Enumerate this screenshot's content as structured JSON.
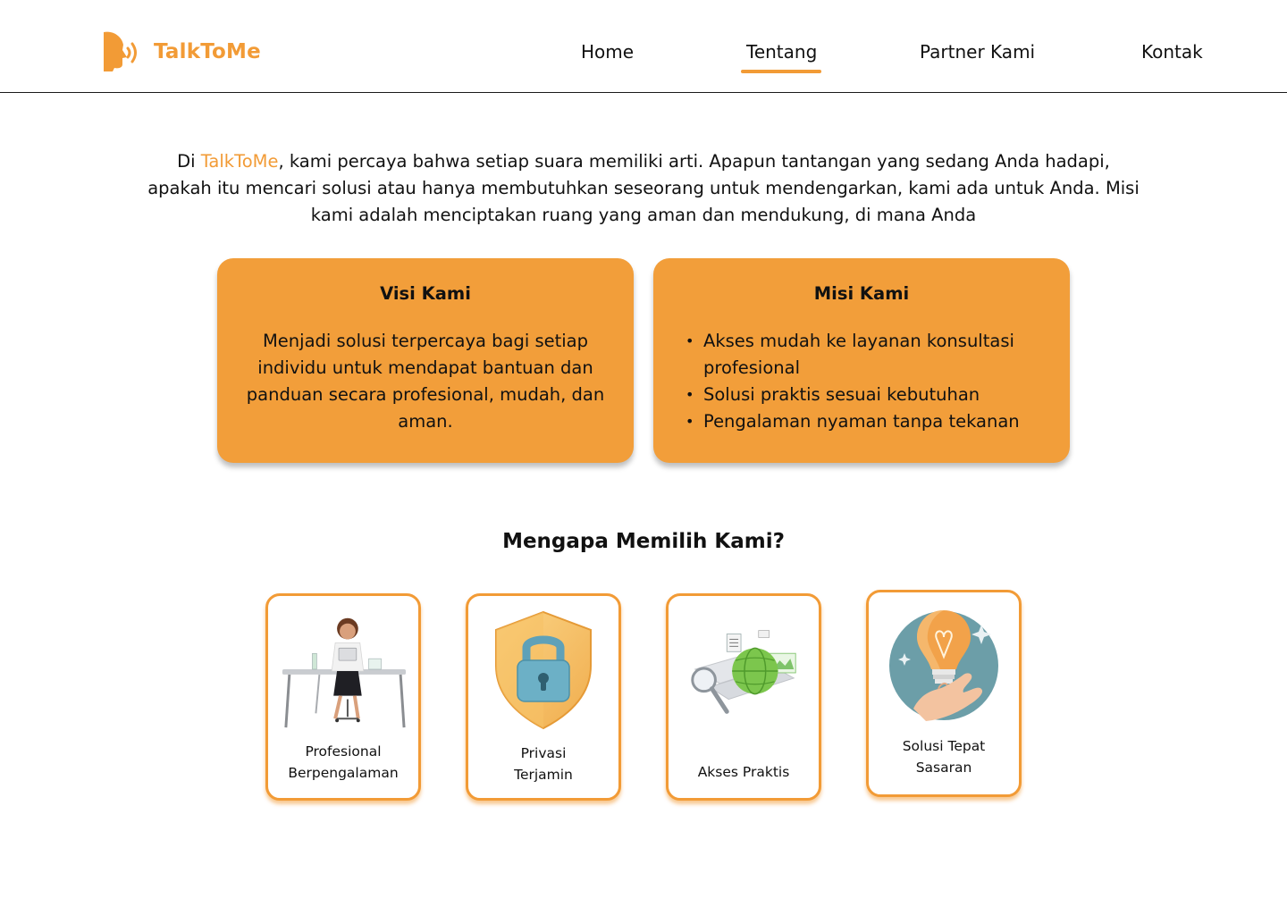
{
  "brand": {
    "name": "TalkToMe",
    "color": "#f29b36"
  },
  "nav": {
    "items": [
      {
        "label": "Home",
        "active": false
      },
      {
        "label": "Tentang",
        "active": true
      },
      {
        "label": "Partner Kami",
        "active": false
      },
      {
        "label": "Kontak",
        "active": false
      }
    ]
  },
  "intro": {
    "prefix": "Di ",
    "brand": "TalkToMe",
    "text": ", kami percaya bahwa setiap suara memiliki arti. Apapun tantangan yang sedang Anda hadapi, apakah itu mencari solusi atau hanya membutuhkan seseorang untuk mendengarkan, kami ada untuk Anda. Misi kami adalah menciptakan ruang yang aman dan mendukung, di mana Anda"
  },
  "visi": {
    "title": "Visi Kami",
    "text": "Menjadi solusi terpercaya bagi setiap individu untuk mendapat bantuan dan panduan secara profesional, mudah, dan aman."
  },
  "misi": {
    "title": "Misi Kami",
    "items": [
      "Akses mudah ke layanan konsultasi profesional",
      "Solusi praktis sesuai kebutuhan",
      "Pengalaman nyaman tanpa tekanan"
    ]
  },
  "why": {
    "title": "Mengapa Memilih Kami?",
    "features": [
      {
        "line1": "Profesional",
        "line2": "Berpengalaman",
        "icon": "professional-desk-illustration"
      },
      {
        "line1": "Privasi",
        "line2": "Terjamin",
        "icon": "shield-lock-illustration"
      },
      {
        "line1": "Akses Praktis",
        "line2": "",
        "icon": "globe-search-illustration"
      },
      {
        "line1": "Solusi Tepat",
        "line2": "Sasaran",
        "icon": "lightbulb-hand-illustration"
      }
    ]
  },
  "colors": {
    "accent": "#f29b36",
    "card": "#f29e3a",
    "text": "#111111"
  }
}
